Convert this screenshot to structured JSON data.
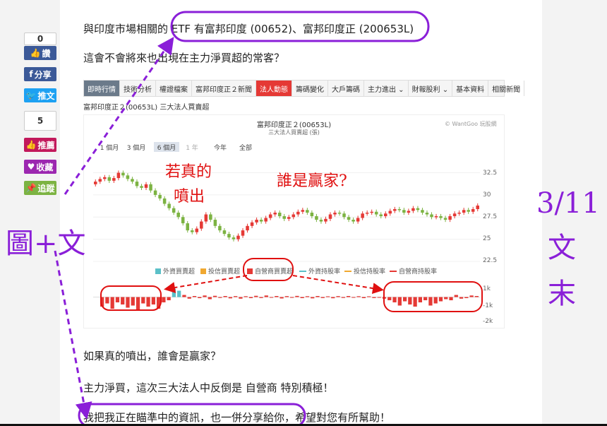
{
  "paragraphs": {
    "p1": "與印度市場相關的 ETF 有富邦印度 (00652)、富邦印度正 (200653L)",
    "p2": "這會不會將來也出現在主力淨買超的常客？",
    "p3": "如果真的噴出，誰會是贏家？",
    "p4": "主力淨買，這次三大法人中反倒是 自營商 特別積極！",
    "p5": "我把我正在瞄準中的資訊，也一併分享給你，希望對您有所幫助！"
  },
  "share": {
    "like_count": "0",
    "like_label": "讚",
    "fb_share": "分享",
    "tw_share": "推文",
    "push_count": "5",
    "push_label": "推薦",
    "fav_label": "收藏",
    "follow_label": "追蹤"
  },
  "tabs": [
    "即時行情",
    "技術分析",
    "權證檔案",
    "富邦印度正２新聞",
    "法人動態",
    "籌碼變化",
    "大戶籌碼",
    "主力進出 ⌄",
    "財報股利 ⌄",
    "基本資料",
    "相關新聞"
  ],
  "active_tab": "法人動態",
  "chart_caption": "富邦印度正２(00653L) 三大法人買賣超",
  "chart_title": "富邦印度正２(00653L)",
  "chart_subtitle": "三大法人買賣超 (張)",
  "watermark": "© WantGoo 玩股網",
  "range_buttons": [
    "1 個月",
    "3 個月",
    "6 個月",
    "1 年",
    "今年",
    "全部"
  ],
  "annotations": {
    "red_left": "若真的噴出",
    "red_left_1": "若真的",
    "red_left_2": "噴出",
    "red_right": "誰是贏家?",
    "purple_left": "圖+文",
    "purple_right_date": "3/11",
    "purple_right_1": "文",
    "purple_right_2": "末"
  },
  "colors": {
    "up": "#e53935",
    "down": "#7cb342",
    "foreign": "#5bc0c8",
    "trust": "#f0a830",
    "dealer": "#e53935",
    "annotation_purple": "#8a1fd8",
    "annotation_red": "#e01010"
  },
  "chart_data": {
    "type": "candlestick+bar",
    "price_axis": {
      "ticks": [
        "32.5",
        "30",
        "27.5",
        "25",
        "22.5"
      ],
      "ylim": [
        22.5,
        33.5
      ]
    },
    "price_close": [
      31.5,
      31.8,
      32.0,
      31.6,
      31.9,
      32.5,
      32.2,
      31.8,
      31.5,
      31.0,
      30.8,
      31.2,
      30.5,
      30.0,
      29.6,
      29.0,
      28.5,
      28.0,
      27.5,
      26.8,
      26.0,
      25.8,
      26.2,
      27.0,
      27.8,
      27.2,
      26.5,
      26.0,
      25.6,
      25.2,
      25.0,
      25.4,
      26.0,
      26.5,
      26.9,
      27.2,
      27.0,
      27.4,
      27.8,
      28.0,
      27.6,
      27.3,
      27.5,
      27.8,
      28.1,
      28.3,
      28.0,
      27.6,
      27.2,
      27.0,
      27.3,
      27.8,
      28.0,
      27.9,
      27.5,
      27.2,
      27.0,
      27.4,
      27.9,
      28.0,
      28.1,
      27.8,
      27.6,
      27.9,
      28.2,
      28.4,
      28.3,
      28.0,
      28.2,
      28.5,
      28.3,
      28.0,
      27.8,
      27.5,
      27.6,
      27.4,
      27.2,
      27.6,
      27.9,
      28.0,
      28.3,
      28.1,
      28.4,
      28.8
    ],
    "legend": [
      "外資買賣超",
      "投信買賣超",
      "自營商買賣超",
      "外資持股率",
      "投信持股率",
      "自營商持股率"
    ],
    "volume_axis": {
      "ticks": [
        "1k",
        "-1k",
        "-2k"
      ],
      "ylim": [
        -2500,
        1500
      ]
    },
    "dealer_net": [
      -900,
      -600,
      -1100,
      -500,
      -700,
      -1000,
      -800,
      -1200,
      -600,
      -900,
      -700,
      -1100,
      -500,
      -300,
      800,
      600,
      200,
      -150,
      100,
      -100,
      150,
      -200,
      120,
      -80,
      100,
      -120,
      90,
      -150,
      80,
      -100,
      120,
      -90,
      150,
      -60,
      100,
      -130,
      90,
      -70,
      110,
      -100,
      80,
      -120,
      100,
      -90,
      70,
      -110,
      90,
      -80,
      100,
      -60,
      80,
      -100,
      70,
      -90,
      -60,
      -150,
      -300,
      -500,
      -800,
      -400,
      -700,
      -900,
      -500,
      -300,
      -800,
      -600,
      -400,
      -200,
      -300,
      200,
      -150,
      -100,
      150,
      100
    ]
  }
}
